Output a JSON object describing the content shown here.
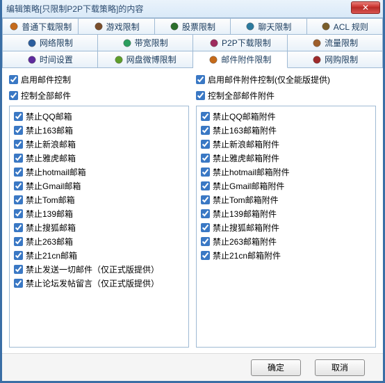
{
  "window": {
    "title": "编辑策略[只限制P2P下载策略]的内容"
  },
  "tabs": {
    "row1": [
      {
        "label": "普通下载限制",
        "name": "tab-download-limit"
      },
      {
        "label": "游戏限制",
        "name": "tab-game-limit"
      },
      {
        "label": "股票限制",
        "name": "tab-stock-limit"
      },
      {
        "label": "聊天限制",
        "name": "tab-chat-limit"
      },
      {
        "label": "ACL 规则",
        "name": "tab-acl-rules"
      }
    ],
    "row2": [
      {
        "label": "网络限制",
        "name": "tab-network-limit"
      },
      {
        "label": "带宽限制",
        "name": "tab-bandwidth-limit"
      },
      {
        "label": "P2P下载限制",
        "name": "tab-p2p-limit"
      },
      {
        "label": "流量限制",
        "name": "tab-traffic-limit"
      }
    ],
    "row3": [
      {
        "label": "时间设置",
        "name": "tab-time-settings"
      },
      {
        "label": "网盘微博限制",
        "name": "tab-netdisk-limit"
      },
      {
        "label": "邮件附件限制",
        "name": "tab-mail-attachment-limit",
        "active": true
      },
      {
        "label": "网购限制",
        "name": "tab-shopping-limit"
      }
    ]
  },
  "left": {
    "enable": "启用邮件控制",
    "all": "控制全部邮件",
    "items": [
      "禁止QQ邮箱",
      "禁止163邮箱",
      "禁止新浪邮箱",
      "禁止雅虎邮箱",
      "禁止hotmail邮箱",
      "禁止Gmail邮箱",
      "禁止Tom邮箱",
      "禁止139邮箱",
      "禁止搜狐邮箱",
      "禁止263邮箱",
      "禁止21cn邮箱",
      "禁止发送一切邮件（仅正式版提供）",
      "禁止论坛发帖留言（仅正式版提供）"
    ]
  },
  "right": {
    "enable": "启用邮件附件控制(仅全能版提供)",
    "all": "控制全部邮件附件",
    "items": [
      "禁止QQ邮箱附件",
      "禁止163邮箱附件",
      "禁止新浪邮箱附件",
      "禁止雅虎邮箱附件",
      "禁止hotmail邮箱附件",
      "禁止Gmail邮箱附件",
      "禁止Tom邮箱附件",
      "禁止139邮箱附件",
      "禁止搜狐邮箱附件",
      "禁止263邮箱附件",
      "禁止21cn邮箱附件"
    ]
  },
  "footer": {
    "ok": "确定",
    "cancel": "取消"
  },
  "icons": {
    "colors": {
      "download": "#c56a1a",
      "game": "#7a4e2b",
      "stock": "#2b6e2b",
      "chat": "#2b7a9e",
      "acl": "#7a5e2b",
      "network": "#2b5e9e",
      "bandwidth": "#2b9e5e",
      "p2p": "#9e2b5e",
      "traffic": "#9e5e2b",
      "time": "#5e2b9e",
      "netdisk": "#5e9e2b",
      "mail": "#c56a1a",
      "shop": "#9e2b2b"
    }
  }
}
